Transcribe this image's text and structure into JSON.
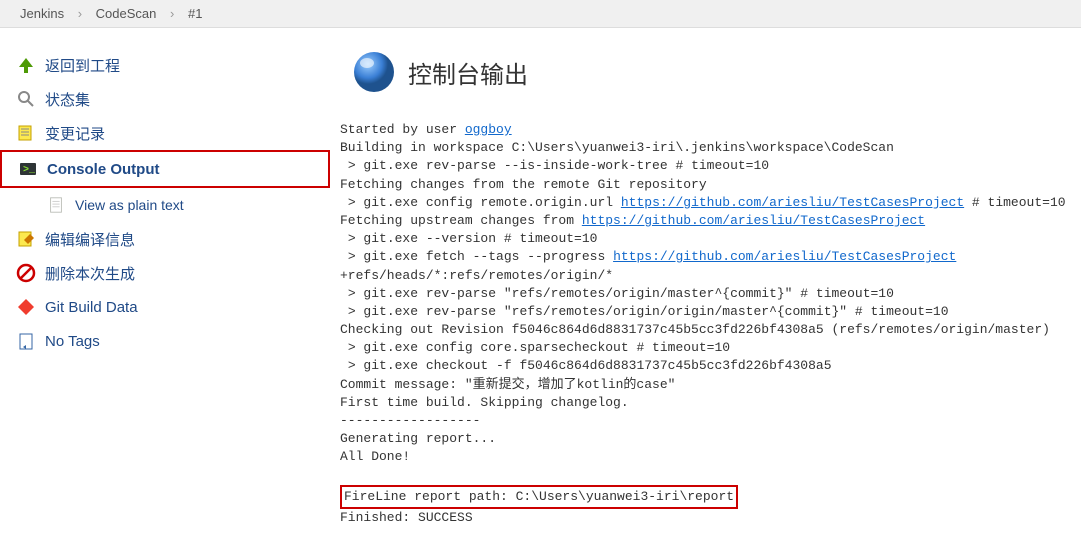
{
  "breadcrumb": {
    "jenkins": "Jenkins",
    "job": "CodeScan",
    "build": "#1"
  },
  "sidebar": {
    "back": "返回到工程",
    "status": "状态集",
    "changes": "变更记录",
    "console": "Console Output",
    "plaintext": "View as plain text",
    "editbuild": "编辑编译信息",
    "delete": "删除本次生成",
    "gitdata": "Git Build Data",
    "notags": "No Tags"
  },
  "title": "控制台输出",
  "console": {
    "started_by": "Started by user ",
    "user_link": "oggboy",
    "building": "Building in workspace C:\\Users\\yuanwei3-iri\\.jenkins\\workspace\\CodeScan",
    "l3": " > git.exe rev-parse --is-inside-work-tree # timeout=10",
    "l4": "Fetching changes from the remote Git repository",
    "l5a": " > git.exe config remote.origin.url ",
    "l5_link": "https://github.com/ariesliu/TestCasesProject",
    "l5b": " # timeout=10",
    "l6a": "Fetching upstream changes from ",
    "l6_link": "https://github.com/ariesliu/TestCasesProject",
    "l7": " > git.exe --version # timeout=10",
    "l8a": " > git.exe fetch --tags --progress ",
    "l8_link": "https://github.com/ariesliu/TestCasesProject",
    "l8b": " +refs/heads/*:refs/remotes/origin/*",
    "l9": " > git.exe rev-parse \"refs/remotes/origin/master^{commit}\" # timeout=10",
    "l10": " > git.exe rev-parse \"refs/remotes/origin/origin/master^{commit}\" # timeout=10",
    "l11": "Checking out Revision f5046c864d6d8831737c45b5cc3fd226bf4308a5 (refs/remotes/origin/master)",
    "l12": " > git.exe config core.sparsecheckout # timeout=10",
    "l13": " > git.exe checkout -f f5046c864d6d8831737c45b5cc3fd226bf4308a5",
    "l14": "Commit message: \"重新提交，增加了kotlin的case\"",
    "l15": "First time build. Skipping changelog.",
    "l16": "------------------",
    "l17": "Generating report...",
    "l18": "All Done!",
    "l19": "",
    "l20": "FireLine report path: C:\\Users\\yuanwei3-iri\\report",
    "l21": "Finished: SUCCESS"
  }
}
